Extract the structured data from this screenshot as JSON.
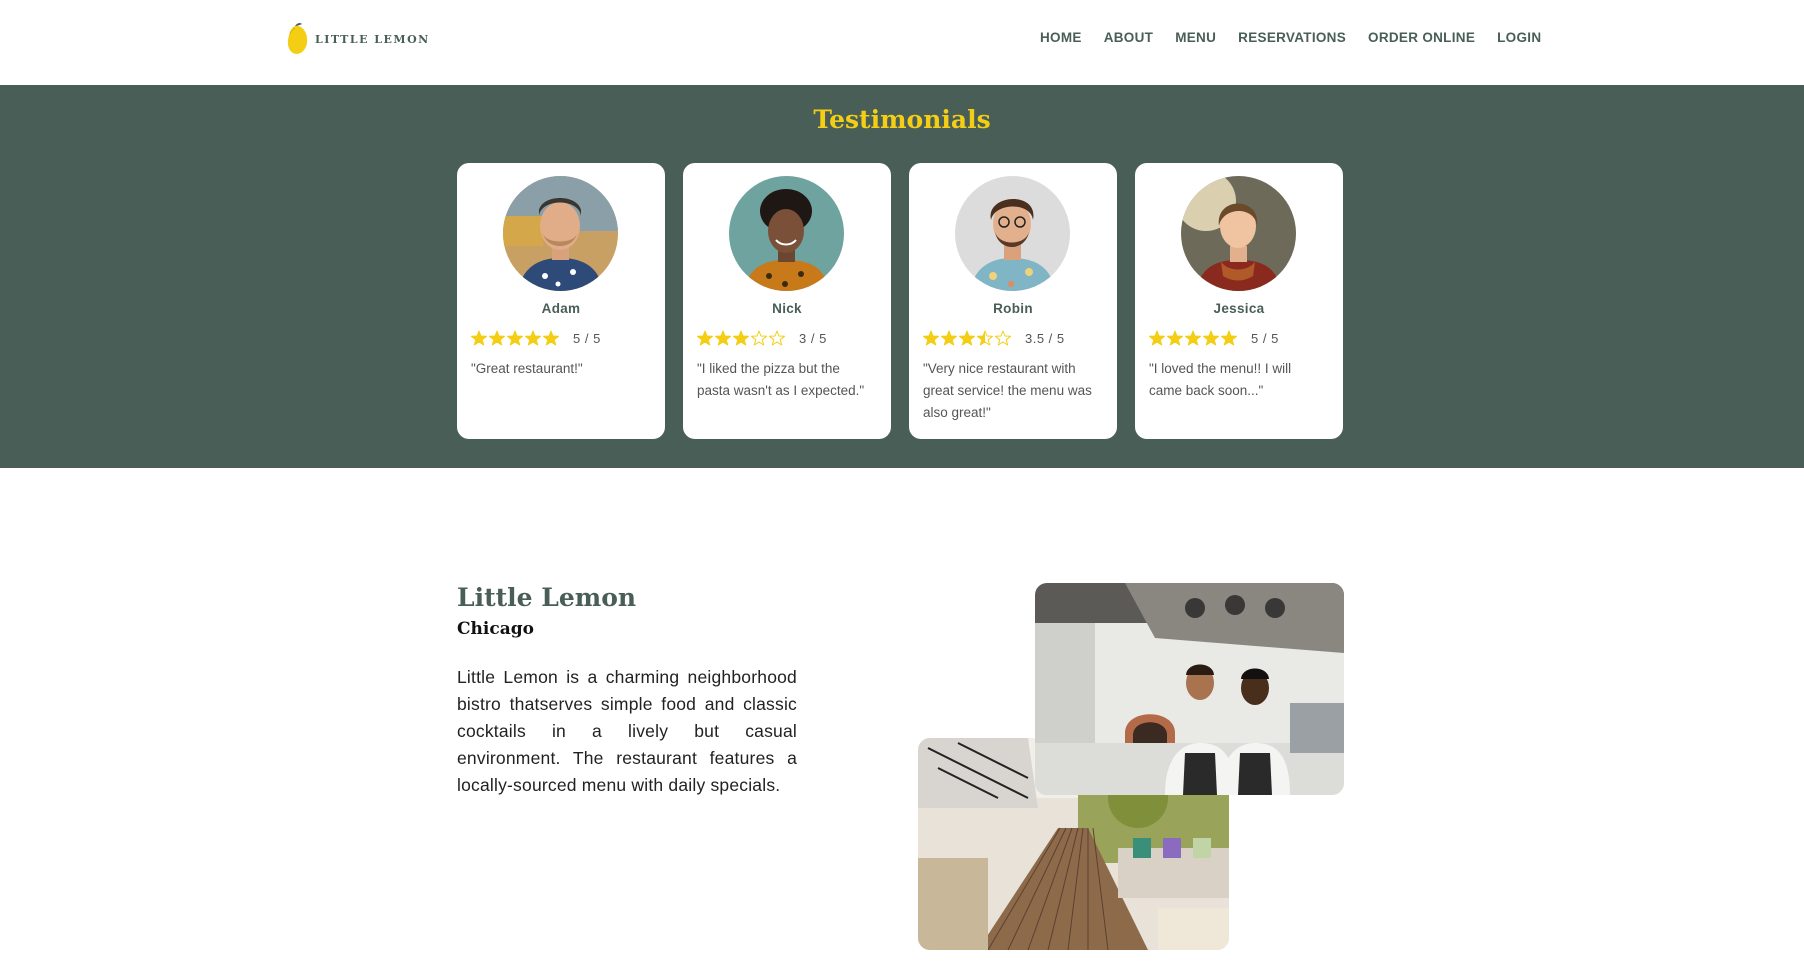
{
  "header": {
    "logo_text": "LITTLE LEMON",
    "nav": [
      "HOME",
      "ABOUT",
      "MENU",
      "RESERVATIONS",
      "ORDER ONLINE",
      "LOGIN"
    ]
  },
  "testimonials": {
    "title": "Testimonials",
    "cards": [
      {
        "name": "Adam",
        "rating": 5,
        "rating_text": "5 / 5",
        "quote": "\"Great restaurant!\""
      },
      {
        "name": "Nick",
        "rating": 3,
        "rating_text": "3 / 5",
        "quote": "\"I liked the pizza but the pasta wasn't as I expected.\""
      },
      {
        "name": "Robin",
        "rating": 3.5,
        "rating_text": "3.5 / 5",
        "quote": "\"Very nice restaurant with great service! the menu was also great!\""
      },
      {
        "name": "Jessica",
        "rating": 5,
        "rating_text": "5 / 5",
        "quote": "\"I loved the menu!! I will came back soon...\""
      }
    ]
  },
  "about": {
    "title": "Little Lemon",
    "subtitle": "Chicago",
    "text": "Little Lemon is a charming neighborhood bistro thatserves simple food and classic cocktails in a lively but casual environment. The restaurant features a locally-sourced menu with daily specials."
  },
  "colors": {
    "primary_green": "#495e57",
    "primary_yellow": "#f4ce14",
    "star": "#f4ce14"
  }
}
